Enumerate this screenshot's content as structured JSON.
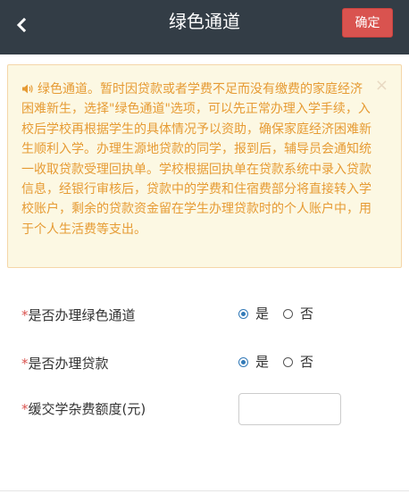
{
  "header": {
    "title": "绿色通道",
    "back_icon": "chevron-left-icon",
    "confirm_label": "确定",
    "background": "#333d46",
    "confirm_color": "#d9534f"
  },
  "notice": {
    "icon": "speaker-icon",
    "text": "绿色通道。暂时因贷款或者学费不足而没有缴费的家庭经济困难新生，选择\"绿色通道\"选项，可以先正常办理入学手续，入校后学校再根据学生的具体情况予以资助，确保家庭经济困难新生顺利入学。办理生源地贷款的同学，报到后，辅导员会通知统一收取贷款受理回执单。学校根据回执单在贷款系统中录入贷款信息，经银行审核后，贷款中的学费和住宿费部分将直接转入学校账户，剩余的贷款资金留在学生办理贷款时的个人账户中，用于个人生活费等支出。",
    "close_symbol": "×",
    "text_color": "#e69b34",
    "background": "#fcf8e3"
  },
  "form": {
    "required_mark": "*",
    "green_channel": {
      "label": "是否办理绿色通道",
      "options": [
        "是",
        "否"
      ],
      "selected": "是"
    },
    "loan": {
      "label": "是否办理贷款",
      "options": [
        "是",
        "否"
      ],
      "selected": "是"
    },
    "deferred_fee": {
      "label": "缓交学杂费额度(元)",
      "value": "",
      "placeholder": ""
    }
  }
}
